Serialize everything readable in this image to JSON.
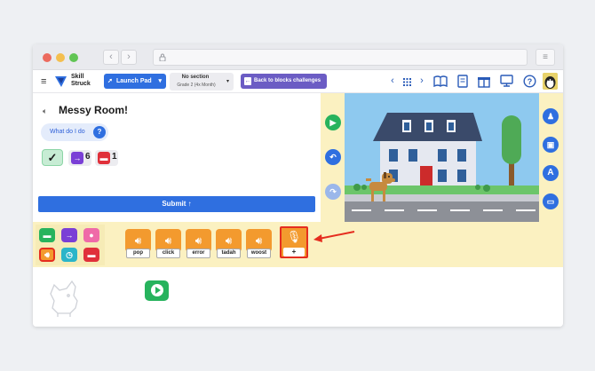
{
  "app": {
    "logo_line1": "Skill",
    "logo_line2": "Struck",
    "launch_pad": "Launch Pad",
    "section_title": "No section",
    "section_sub": "Grade 2 (4x Month)",
    "back_button": "Back to blocks challenges"
  },
  "challenge": {
    "title": "Messy Room!",
    "help_label": "What do I do",
    "help_icon": "?",
    "counts": [
      {
        "icon": "arrow-right-icon",
        "color": "#7a3fd6",
        "value": "6"
      },
      {
        "icon": "stop-icon",
        "color": "#e0303a",
        "value": "1"
      }
    ],
    "submit_label": "Submit"
  },
  "palette": [
    {
      "name": "palette-green-block",
      "color": "#27b35d"
    },
    {
      "name": "palette-move-block",
      "color": "#7a3fd6"
    },
    {
      "name": "palette-speech-block",
      "color": "#ef6aa8"
    },
    {
      "name": "palette-sound-block",
      "color": "#f39a2e"
    },
    {
      "name": "palette-timer-block",
      "color": "#2bb5c9"
    },
    {
      "name": "palette-stop-block",
      "color": "#e0303a"
    }
  ],
  "sounds": [
    "pop",
    "click",
    "error",
    "tadah",
    "woost"
  ],
  "colors": {
    "accent": "#2f6fe0",
    "purple": "#6b5cc4",
    "panel_yellow": "#fbf1c1",
    "sound_orange": "#f39a2e",
    "highlight_red": "#e52d1f"
  }
}
